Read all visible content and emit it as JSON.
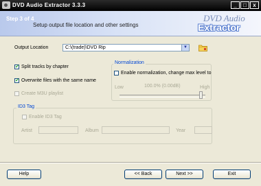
{
  "window": {
    "title": "DVD Audio Extractor 3.3.3",
    "minimize_glyph": "_",
    "maximize_glyph": "□",
    "close_glyph": "x"
  },
  "header": {
    "step": "Step 3 of 4",
    "subtitle": "Setup output file location and other settings",
    "logo_top": "DVD Audio",
    "logo_bottom": "Extractor"
  },
  "output": {
    "label": "Output Location",
    "value": "C:\\(trade)\\DVD Rip",
    "arrow": "▼"
  },
  "options": {
    "split_tracks": {
      "label": "Split tracks by chapter",
      "checked": true
    },
    "overwrite": {
      "label": "Overwrite files with the same name",
      "checked": true
    },
    "m3u": {
      "label": "Create M3U playlist",
      "checked": false,
      "disabled": true
    }
  },
  "normalization": {
    "title": "Normalization",
    "enable_label": "Enable normalization, change max level to",
    "low": "Low",
    "high": "High",
    "value": "100.0% (0.00dB)",
    "level": 1.0
  },
  "id3": {
    "title": "ID3 Tag",
    "enable_label": "Enable ID3 Tag",
    "artist_label": "Artist",
    "album_label": "Album",
    "year_label": "Year",
    "artist": "",
    "album": "",
    "year": ""
  },
  "buttons": {
    "help": "Help",
    "back": "<< Back",
    "next": "Next >>",
    "exit": "Exit"
  },
  "colors": {
    "titlebar": "#000000",
    "header_gradient_start": "#b9c9ec",
    "group_title": "#0046d5",
    "check": "#21a121"
  }
}
